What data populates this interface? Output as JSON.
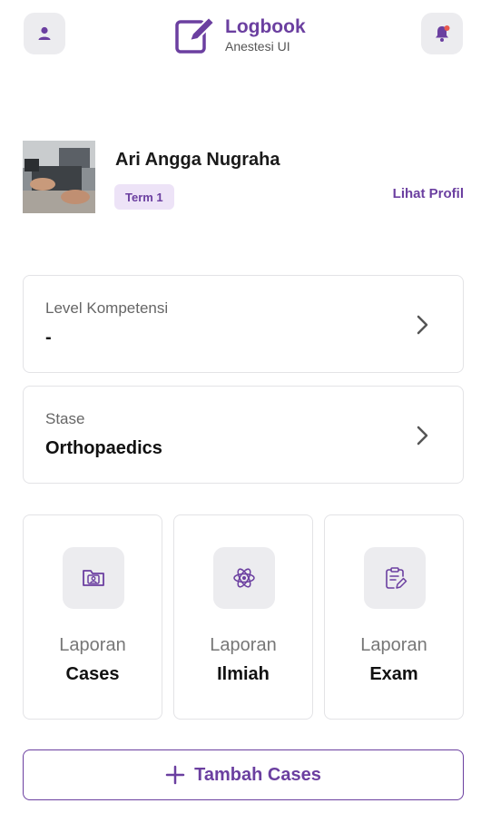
{
  "header": {
    "brand_title": "Logbook",
    "brand_subtitle": "Anestesi UI",
    "profile_icon": "user-icon",
    "notification_icon": "bell-icon",
    "brand_icon": "edit-note-icon"
  },
  "profile": {
    "name": "Ari Angga Nugraha",
    "term": "Term 1",
    "view_profile_link": "Lihat Profil"
  },
  "cards": {
    "level": {
      "label": "Level Kompetensi",
      "value": "-"
    },
    "stase": {
      "label": "Stase",
      "value": "Orthopaedics"
    }
  },
  "reports": [
    {
      "line1": "Laporan",
      "line2": "Cases",
      "icon": "folder-user-icon"
    },
    {
      "line1": "Laporan",
      "line2": "Ilmiah",
      "icon": "atom-icon"
    },
    {
      "line1": "Laporan",
      "line2": "Exam",
      "icon": "clipboard-edit-icon"
    }
  ],
  "add_button": {
    "label": "Tambah Cases",
    "icon": "plus-icon"
  },
  "colors": {
    "accent": "#6b3fa0",
    "badge_bg": "#ede3f7",
    "icon_bg": "#ececef",
    "notification_dot": "#e85a4f"
  }
}
